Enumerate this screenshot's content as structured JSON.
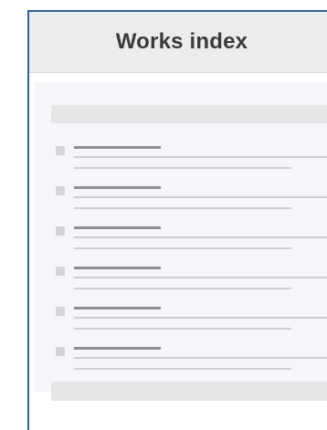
{
  "header": {
    "title": "Works index"
  },
  "list": {
    "item_count": 6
  },
  "colors": {
    "frame_border": "#2e5f97",
    "header_bg": "#ececec",
    "panel_bg": "#f4f6f9",
    "placeholder_dark": "#8f8f8f",
    "placeholder_light": "#cfcfcf",
    "checkbox": "#d4d4d4",
    "band": "#e6e6e6"
  }
}
